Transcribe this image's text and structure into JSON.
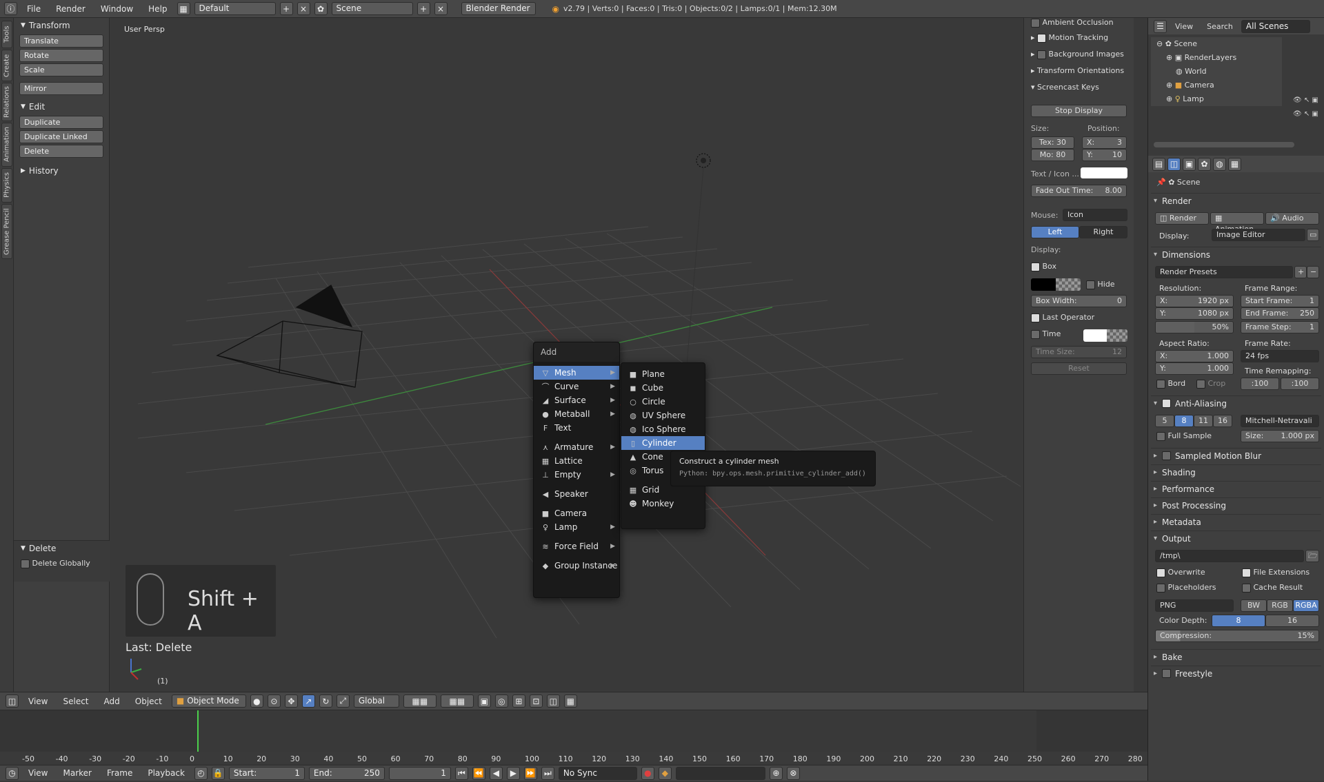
{
  "topbar": {
    "menus": [
      "File",
      "Render",
      "Window",
      "Help"
    ],
    "layout": "Default",
    "scene": "Scene",
    "engine": "Blender Render",
    "stats": "v2.79 | Verts:0 | Faces:0 | Tris:0 | Objects:0/2 | Lamps:0/1 | Mem:12.30M"
  },
  "left_tabs": [
    "Tools",
    "Create",
    "Relations",
    "Animation",
    "Physics",
    "Grease Pencil"
  ],
  "toolshelf": {
    "transform_title": "Transform",
    "transform_buttons": [
      "Translate",
      "Rotate",
      "Scale"
    ],
    "mirror": "Mirror",
    "edit_title": "Edit",
    "edit_buttons": [
      "Duplicate",
      "Duplicate Linked",
      "Delete"
    ],
    "history_title": "History",
    "delete_title": "Delete",
    "delete_globally": "Delete Globally"
  },
  "viewport": {
    "label": "User Persp",
    "key_display": "Shift + A",
    "last_op": "Last: Delete",
    "frame": "(1)"
  },
  "add_menu": {
    "title": "Add",
    "items": [
      {
        "label": "Mesh",
        "icon": "▽",
        "sub": true
      },
      {
        "label": "Curve",
        "icon": "⌒",
        "sub": true
      },
      {
        "label": "Surface",
        "icon": "◢",
        "sub": true
      },
      {
        "label": "Metaball",
        "icon": "●",
        "sub": true
      },
      {
        "label": "Text",
        "icon": "F",
        "sub": false
      },
      {
        "label": "Armature",
        "icon": "⋏",
        "sub": true
      },
      {
        "label": "Lattice",
        "icon": "▦",
        "sub": false
      },
      {
        "label": "Empty",
        "icon": "⊥",
        "sub": true
      },
      {
        "label": "Speaker",
        "icon": "◀",
        "sub": false
      },
      {
        "label": "Camera",
        "icon": "■",
        "sub": false
      },
      {
        "label": "Lamp",
        "icon": "♀",
        "sub": true
      },
      {
        "label": "Force Field",
        "icon": "≋",
        "sub": true
      },
      {
        "label": "Group Instance",
        "icon": "◆",
        "sub": true
      }
    ]
  },
  "mesh_menu": {
    "items": [
      {
        "label": "Plane",
        "icon": "■"
      },
      {
        "label": "Cube",
        "icon": "◼"
      },
      {
        "label": "Circle",
        "icon": "○"
      },
      {
        "label": "UV Sphere",
        "icon": "◍"
      },
      {
        "label": "Ico Sphere",
        "icon": "◍"
      },
      {
        "label": "Cylinder",
        "icon": "▯"
      },
      {
        "label": "Cone",
        "icon": "▲"
      },
      {
        "label": "Torus",
        "icon": "◎"
      },
      {
        "label": "Grid",
        "icon": "▦"
      },
      {
        "label": "Monkey",
        "icon": "☻"
      }
    ]
  },
  "tooltip": {
    "title": "Construct a cylinder mesh",
    "python": "Python: bpy.ops.mesh.primitive_cylinder_add()"
  },
  "npanel": {
    "items_top": [
      "Ambient Occlusion",
      "Motion Tracking",
      "Background Images",
      "Transform Orientations",
      "Screencast Keys"
    ],
    "stop_display": "Stop Display",
    "size_label": "Size:",
    "position_label": "Position:",
    "tex": "Tex: 30",
    "mo": "Mo: 80",
    "pos_x": "X:",
    "pos_x_val": "3",
    "pos_y": "Y:",
    "pos_y_val": "10",
    "text_icon": "Text / Icon ...",
    "fade_out_label": "Fade Out Time:",
    "fade_out_val": "8.00",
    "mouse_label": "Mouse:",
    "mouse_val": "Icon",
    "left": "Left",
    "right": "Right",
    "display_label": "Display:",
    "box": "Box",
    "hide": "Hide",
    "box_width_label": "Box Width:",
    "box_width_val": "0",
    "last_operator": "Last Operator",
    "time": "Time",
    "time_size_label": "Time Size:",
    "time_size_val": "12",
    "reset": "Reset"
  },
  "outliner": {
    "tabs": [
      "View",
      "Search",
      "All Scenes"
    ],
    "tree": [
      "Scene",
      "RenderLayers",
      "World",
      "Camera",
      "Lamp"
    ]
  },
  "properties": {
    "breadcrumb": "Scene",
    "render_title": "Render",
    "render_buttons": [
      "Render",
      "Animation",
      "Audio"
    ],
    "display_label": "Display:",
    "display_val": "Image Editor",
    "dimensions_title": "Dimensions",
    "render_presets": "Render Presets",
    "resolution_label": "Resolution:",
    "res_x": "X:",
    "res_x_val": "1920 px",
    "res_y": "Y:",
    "res_y_val": "1080 px",
    "res_pct": "50%",
    "frame_range_label": "Frame Range:",
    "start_frame": "Start Frame:",
    "start_frame_val": "1",
    "end_frame": "End Frame:",
    "end_frame_val": "250",
    "frame_step": "Frame Step:",
    "frame_step_val": "1",
    "aspect_label": "Aspect Ratio:",
    "asp_x": "X:",
    "asp_x_val": "1.000",
    "asp_y": "Y:",
    "asp_y_val": "1.000",
    "frame_rate_label": "Frame Rate:",
    "frame_rate_val": "24 fps",
    "time_remap_label": "Time Remapping:",
    "remap_a": ":100",
    "remap_b": ":100",
    "bord": "Bord",
    "crop": "Crop",
    "aa_title": "Anti-Aliasing",
    "aa_samples": [
      "5",
      "8",
      "11",
      "16"
    ],
    "aa_filter": "Mitchell-Netravali",
    "full_sample": "Full Sample",
    "aa_size": "Size:",
    "aa_size_val": "1.000 px",
    "sections_mid": [
      "Sampled Motion Blur",
      "Shading",
      "Performance",
      "Post Processing",
      "Metadata"
    ],
    "output_title": "Output",
    "output_path": "/tmp\\",
    "overwrite": "Overwrite",
    "file_ext": "File Extensions",
    "placeholders": "Placeholders",
    "cache_result": "Cache Result",
    "format": "PNG",
    "color_modes": [
      "BW",
      "RGB",
      "RGBA"
    ],
    "color_depth_label": "Color Depth:",
    "depth_8": "8",
    "depth_16": "16",
    "compression_label": "Compression:",
    "compression_val": "15%",
    "bake": "Bake",
    "freestyle": "Freestyle"
  },
  "viewport_header": {
    "menus": [
      "View",
      "Select",
      "Add",
      "Object"
    ],
    "mode": "Object Mode",
    "orientation": "Global"
  },
  "timeline": {
    "ticks": [
      "-50",
      "-40",
      "-30",
      "-20",
      "-10",
      "0",
      "10",
      "20",
      "30",
      "40",
      "50",
      "60",
      "70",
      "80",
      "90",
      "100",
      "110",
      "120",
      "130",
      "140",
      "150",
      "160",
      "170",
      "180",
      "190",
      "200",
      "210",
      "220",
      "230",
      "240",
      "250",
      "260",
      "270",
      "280"
    ],
    "menus": [
      "View",
      "Marker",
      "Frame",
      "Playback"
    ],
    "start_label": "Start:",
    "start_val": "1",
    "end_label": "End:",
    "end_val": "250",
    "current": "1",
    "sync": "No Sync"
  },
  "colors": {
    "accent": "#5680c2",
    "menu_bg": "#1a1a1a",
    "panel_bg": "#3f3f3f"
  }
}
